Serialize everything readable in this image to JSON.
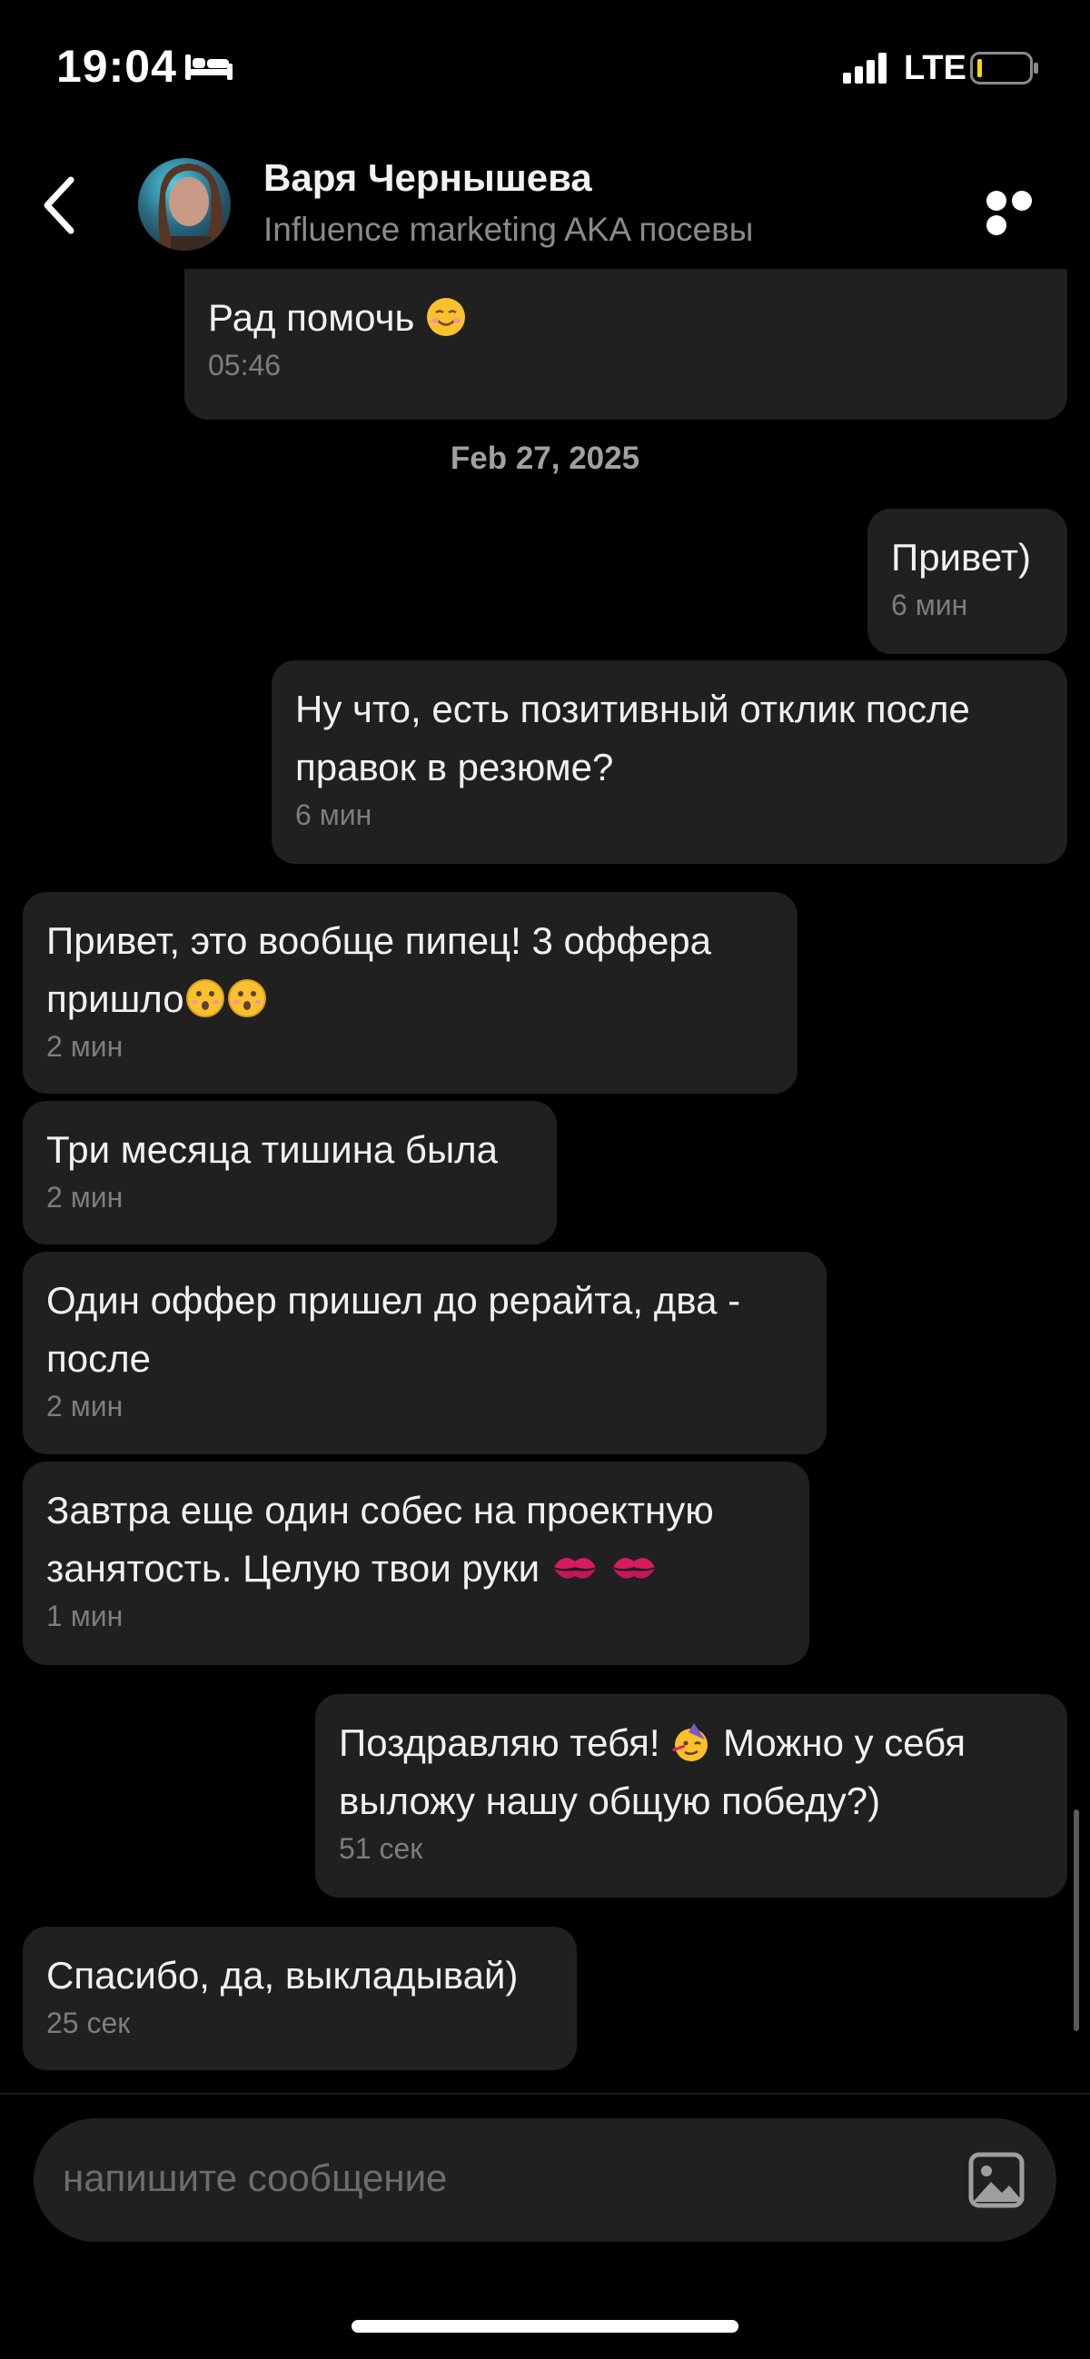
{
  "status_bar": {
    "time": "19:04",
    "network": "LTE",
    "bed_icon": "bed-icon",
    "signal_icon": "signal-icon",
    "battery_icon": "battery-low-icon",
    "battery_accent": "#f5d90a"
  },
  "header": {
    "name": "Варя Чернышева",
    "subtitle": "Influence marketing AKA посевы",
    "back_icon": "chevron-left-icon",
    "more_icon": "more-horizontal-icon"
  },
  "date_separator": "Feb 27, 2025",
  "messages": [
    {
      "side": "incoming",
      "text": "Рад помочь",
      "emoji_after": "smiling-face-icon",
      "time": "05:46"
    },
    {
      "side": "outgoing",
      "text": "Привет)",
      "time": "6 мин"
    },
    {
      "side": "outgoing",
      "text": "Ну что, есть позитивный отклик после\nправок в резюме?",
      "time": "6 мин"
    },
    {
      "side": "incoming",
      "text": "Привет, это вообще пипец! 3 оффера\nпришло",
      "emoji_after": "astonished-face-icon x2",
      "time": "2 мин"
    },
    {
      "side": "incoming",
      "text": "Три месяца тишина была",
      "time": "2 мин"
    },
    {
      "side": "incoming",
      "text": "Один оффер пришел до рерайта, два -\nпосле",
      "time": "2 мин"
    },
    {
      "side": "incoming",
      "text": "Завтра еще один собес на проектную\nзанятость. Целую твои руки",
      "emoji_after": "kiss-mark-icon x2",
      "time": "1 мин"
    },
    {
      "side": "outgoing",
      "text_before": "Поздравляю тебя!",
      "emoji_mid": "partying-face-icon",
      "text": "Можно у себя\nвыложу нашу общую победу?)",
      "time": "51 сек"
    },
    {
      "side": "incoming",
      "text": "Спасибо, да, выкладывай)",
      "time": "25 сек"
    }
  ],
  "composer": {
    "placeholder": "напишите сообщение",
    "attach_icon": "image-attach-icon"
  },
  "colors": {
    "background": "#000000",
    "bubble": "#202020",
    "muted_text": "#7d7d7d"
  }
}
